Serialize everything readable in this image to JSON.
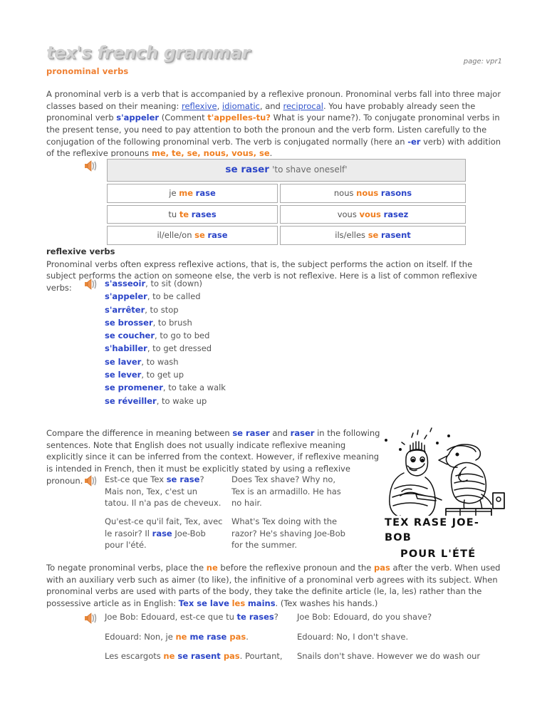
{
  "header": {
    "site_title": "tex's french grammar",
    "page_subtitle": "pronominal verbs",
    "page_ref": "page: vpr1"
  },
  "intro": {
    "p1_a": "A pronominal verb is a verb that is accompanied by a reflexive pronoun. Pronominal verbs fall into three major classes based on their meaning: ",
    "link_reflexive": "reflexive",
    "sep1": ", ",
    "link_idiomatic": "idiomatic",
    "sep2": ", and ",
    "link_reciprocal": "reciprocal",
    "p1_b": ". You have probably already seen the pronominal verb ",
    "verb_sappeler": "s'appeler",
    "p1_c": " (Comment ",
    "q_tappelles": "t'appelles-tu?",
    "p1_d": " What is your name?). To conjugate pronominal verbs in the present tense, you need to pay attention to both the pronoun and the verb form. Listen carefully to the conjugation of the following pronominal verb. The verb is conjugated normally (here an ",
    "er": "-er",
    "p1_e": " verb) with addition of the reflexive pronouns ",
    "pronouns": "me, te, se, nous, vous, se",
    "p1_f": "."
  },
  "conjugation": {
    "icon": "speaker-icon",
    "header_verb": "se raser",
    "header_translation": "'to shave oneself'",
    "rows": [
      {
        "left": {
          "subject": "je",
          "pronoun": "me",
          "verb": "rase"
        },
        "right": {
          "subject": "nous",
          "pronoun": "nous",
          "verb": "rasons"
        }
      },
      {
        "left": {
          "subject": "tu",
          "pronoun": "te",
          "verb": "rases"
        },
        "right": {
          "subject": "vous",
          "pronoun": "vous",
          "verb": "rasez"
        }
      },
      {
        "left": {
          "subject": "il/elle/on",
          "pronoun": "se",
          "verb": "rase"
        },
        "right": {
          "subject": "ils/elles",
          "pronoun": "se",
          "verb": "rasent"
        }
      }
    ]
  },
  "reflexive_section": {
    "heading": "reflexive verbs",
    "paragraph": "Pronominal verbs often express reflexive actions, that is, the subject performs the action on itself. If the subject performs the action on someone else, the verb is not reflexive. Here is a list of common reflexive verbs:",
    "icon": "speaker-icon",
    "verbs": [
      {
        "fr": "s'asseoir",
        "en": ", to sit (down)"
      },
      {
        "fr": "s'appeler",
        "en": ", to be called"
      },
      {
        "fr": "s'arrêter",
        "en": ", to stop"
      },
      {
        "fr": "se brosser",
        "en": ", to brush"
      },
      {
        "fr": "se coucher",
        "en": ", to go to bed"
      },
      {
        "fr": "s'habiller",
        "en": ", to get dressed"
      },
      {
        "fr": "se laver",
        "en": ", to wash"
      },
      {
        "fr": "se lever",
        "en": ", to get up"
      },
      {
        "fr": "se promener",
        "en": ", to take a walk"
      },
      {
        "fr": "se réveiller",
        "en": ", to wake up"
      }
    ]
  },
  "compare_section": {
    "p_a": "Compare the difference in meaning between ",
    "verb1": "se raser",
    "p_b": " and ",
    "verb2": "raser",
    "p_c": " in the following sentences. Note that English does not usually indicate reflexive meaning explicitly since it can be inferred from the context. However, if reflexive meaning is intended in French, then it must be explicitly stated by using a reflexive pronoun.",
    "icon": "speaker-icon",
    "examples": [
      {
        "fr_a": "Est-ce que Tex ",
        "fr_hl": "se rase",
        "fr_b": "? Mais non, Tex, c'est un tatou. Il n'a pas de cheveux.",
        "en": "Does Tex shave? Why no, Tex is an armadillo. He has no hair."
      },
      {
        "fr_a": "Qu'est-ce qu'il fait, Tex, avec le rasoir? Il ",
        "fr_hl": "rase",
        "fr_b": " Joe-Bob pour l'été.",
        "en": "What's Tex doing with the razor? He's shaving Joe-Bob for the summer."
      }
    ]
  },
  "cartoon": {
    "name": "tex-shaving-joe-bob-cartoon",
    "caption_line1": "TEX RASE JOE-BOB",
    "caption_line2": "POUR L'ÉTÉ"
  },
  "negation_section": {
    "p_a": "To negate pronominal verbs, place the ",
    "ne": "ne",
    "p_b": " before the reflexive pronoun and the ",
    "pas": "pas",
    "p_c": " after the verb. When used with an auxiliary verb such as aimer (to like), the infinitive of a pronominal verb agrees with its subject. When pronominal verbs are used with parts of the body, they take the definite article (le, la, les) rather than the possessive article as in English: ",
    "ex_blue1": "Tex se lave",
    "ex_orange": "les",
    "ex_blue2": "mains",
    "p_d": ". (Tex washes his hands.)",
    "icon": "speaker-icon",
    "dialogue": [
      {
        "fr_a": "Joe Bob: Edouard, est-ce que tu ",
        "fr_hl1": "te rases",
        "fr_b": "?",
        "fr_hl2": "",
        "fr_c": "",
        "en": "Joe Bob: Edouard, do you shave?"
      },
      {
        "fr_a": "Edouard: Non, je ",
        "fr_ne": "ne",
        "fr_mid": " me rase ",
        "fr_pas": "pas",
        "fr_end": ".",
        "en": "Edouard: No, I don't shave."
      },
      {
        "fr_a": "Les escargots ",
        "fr_ne": "ne",
        "fr_mid": " se rasent ",
        "fr_pas": "pas",
        "fr_end": ". Pourtant,",
        "en": "Snails don't shave. However we do wash our"
      }
    ]
  },
  "colors": {
    "blue": "#2b45c8",
    "orange": "#f07f20",
    "text": "#4a4a4a",
    "title_gray": "#d2d2d2",
    "table_header_bg": "#ececec",
    "table_border": "#aaaaaa"
  }
}
